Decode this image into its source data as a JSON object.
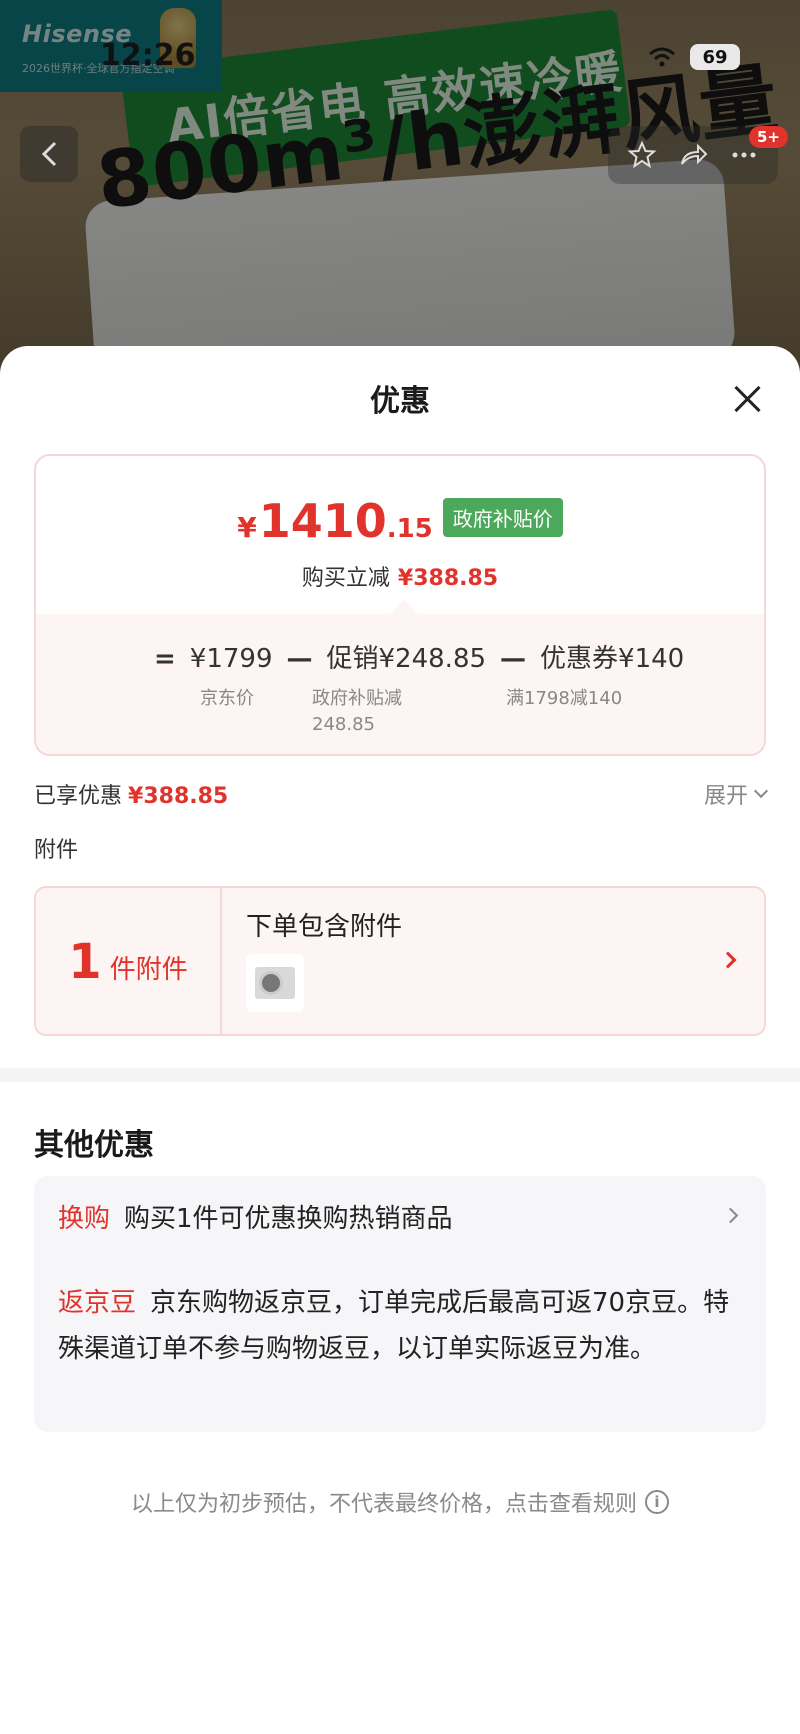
{
  "status_bar": {
    "time": "12:26",
    "battery": "69"
  },
  "banner": {
    "brand": "Hisense",
    "brand_sub": "2026世界杯·全球官方指定空调",
    "slogan": "AI倍省电 高效速冷暖",
    "headline": "800m³/h澎湃风量",
    "badge": "5+"
  },
  "sheet": {
    "title": "优惠",
    "final_price": {
      "symbol": "¥",
      "integer": "1410",
      "decimal": ".15",
      "tag": "政府补贴价"
    },
    "buy_cut": {
      "label": "购买立减",
      "amount": "¥388.85"
    },
    "calc": {
      "equals": "=",
      "base": "¥1799",
      "base_sub": "京东价",
      "minus1": "—",
      "promo": "促销¥248.85",
      "promo_sub1": "政府补贴减",
      "promo_sub2": "248.85",
      "minus2": "—",
      "coupon": "优惠券¥140",
      "coupon_sub": "满1798减140"
    },
    "enjoyed": {
      "label": "已享优惠",
      "amount": "¥388.85"
    },
    "expand_label": "展开",
    "accessories_label": "附件",
    "accessory_card": {
      "count": "1",
      "unit": "件附件",
      "title": "下单包含附件"
    },
    "other_title": "其他优惠",
    "other_items": [
      {
        "tag": "换购",
        "text": "购买1件可优惠换购热销商品"
      },
      {
        "tag": "返京豆",
        "text": "京东购物返京豆，订单完成后最高可返70京豆。特殊渠道订单不参与购物返豆，以订单实际返豆为准。"
      }
    ],
    "footer_note": "以上仅为初步预估，不代表最终价格，点击查看规则",
    "colors": {
      "accent_red": "#e0332c",
      "gov_green": "#4ca85a"
    }
  }
}
